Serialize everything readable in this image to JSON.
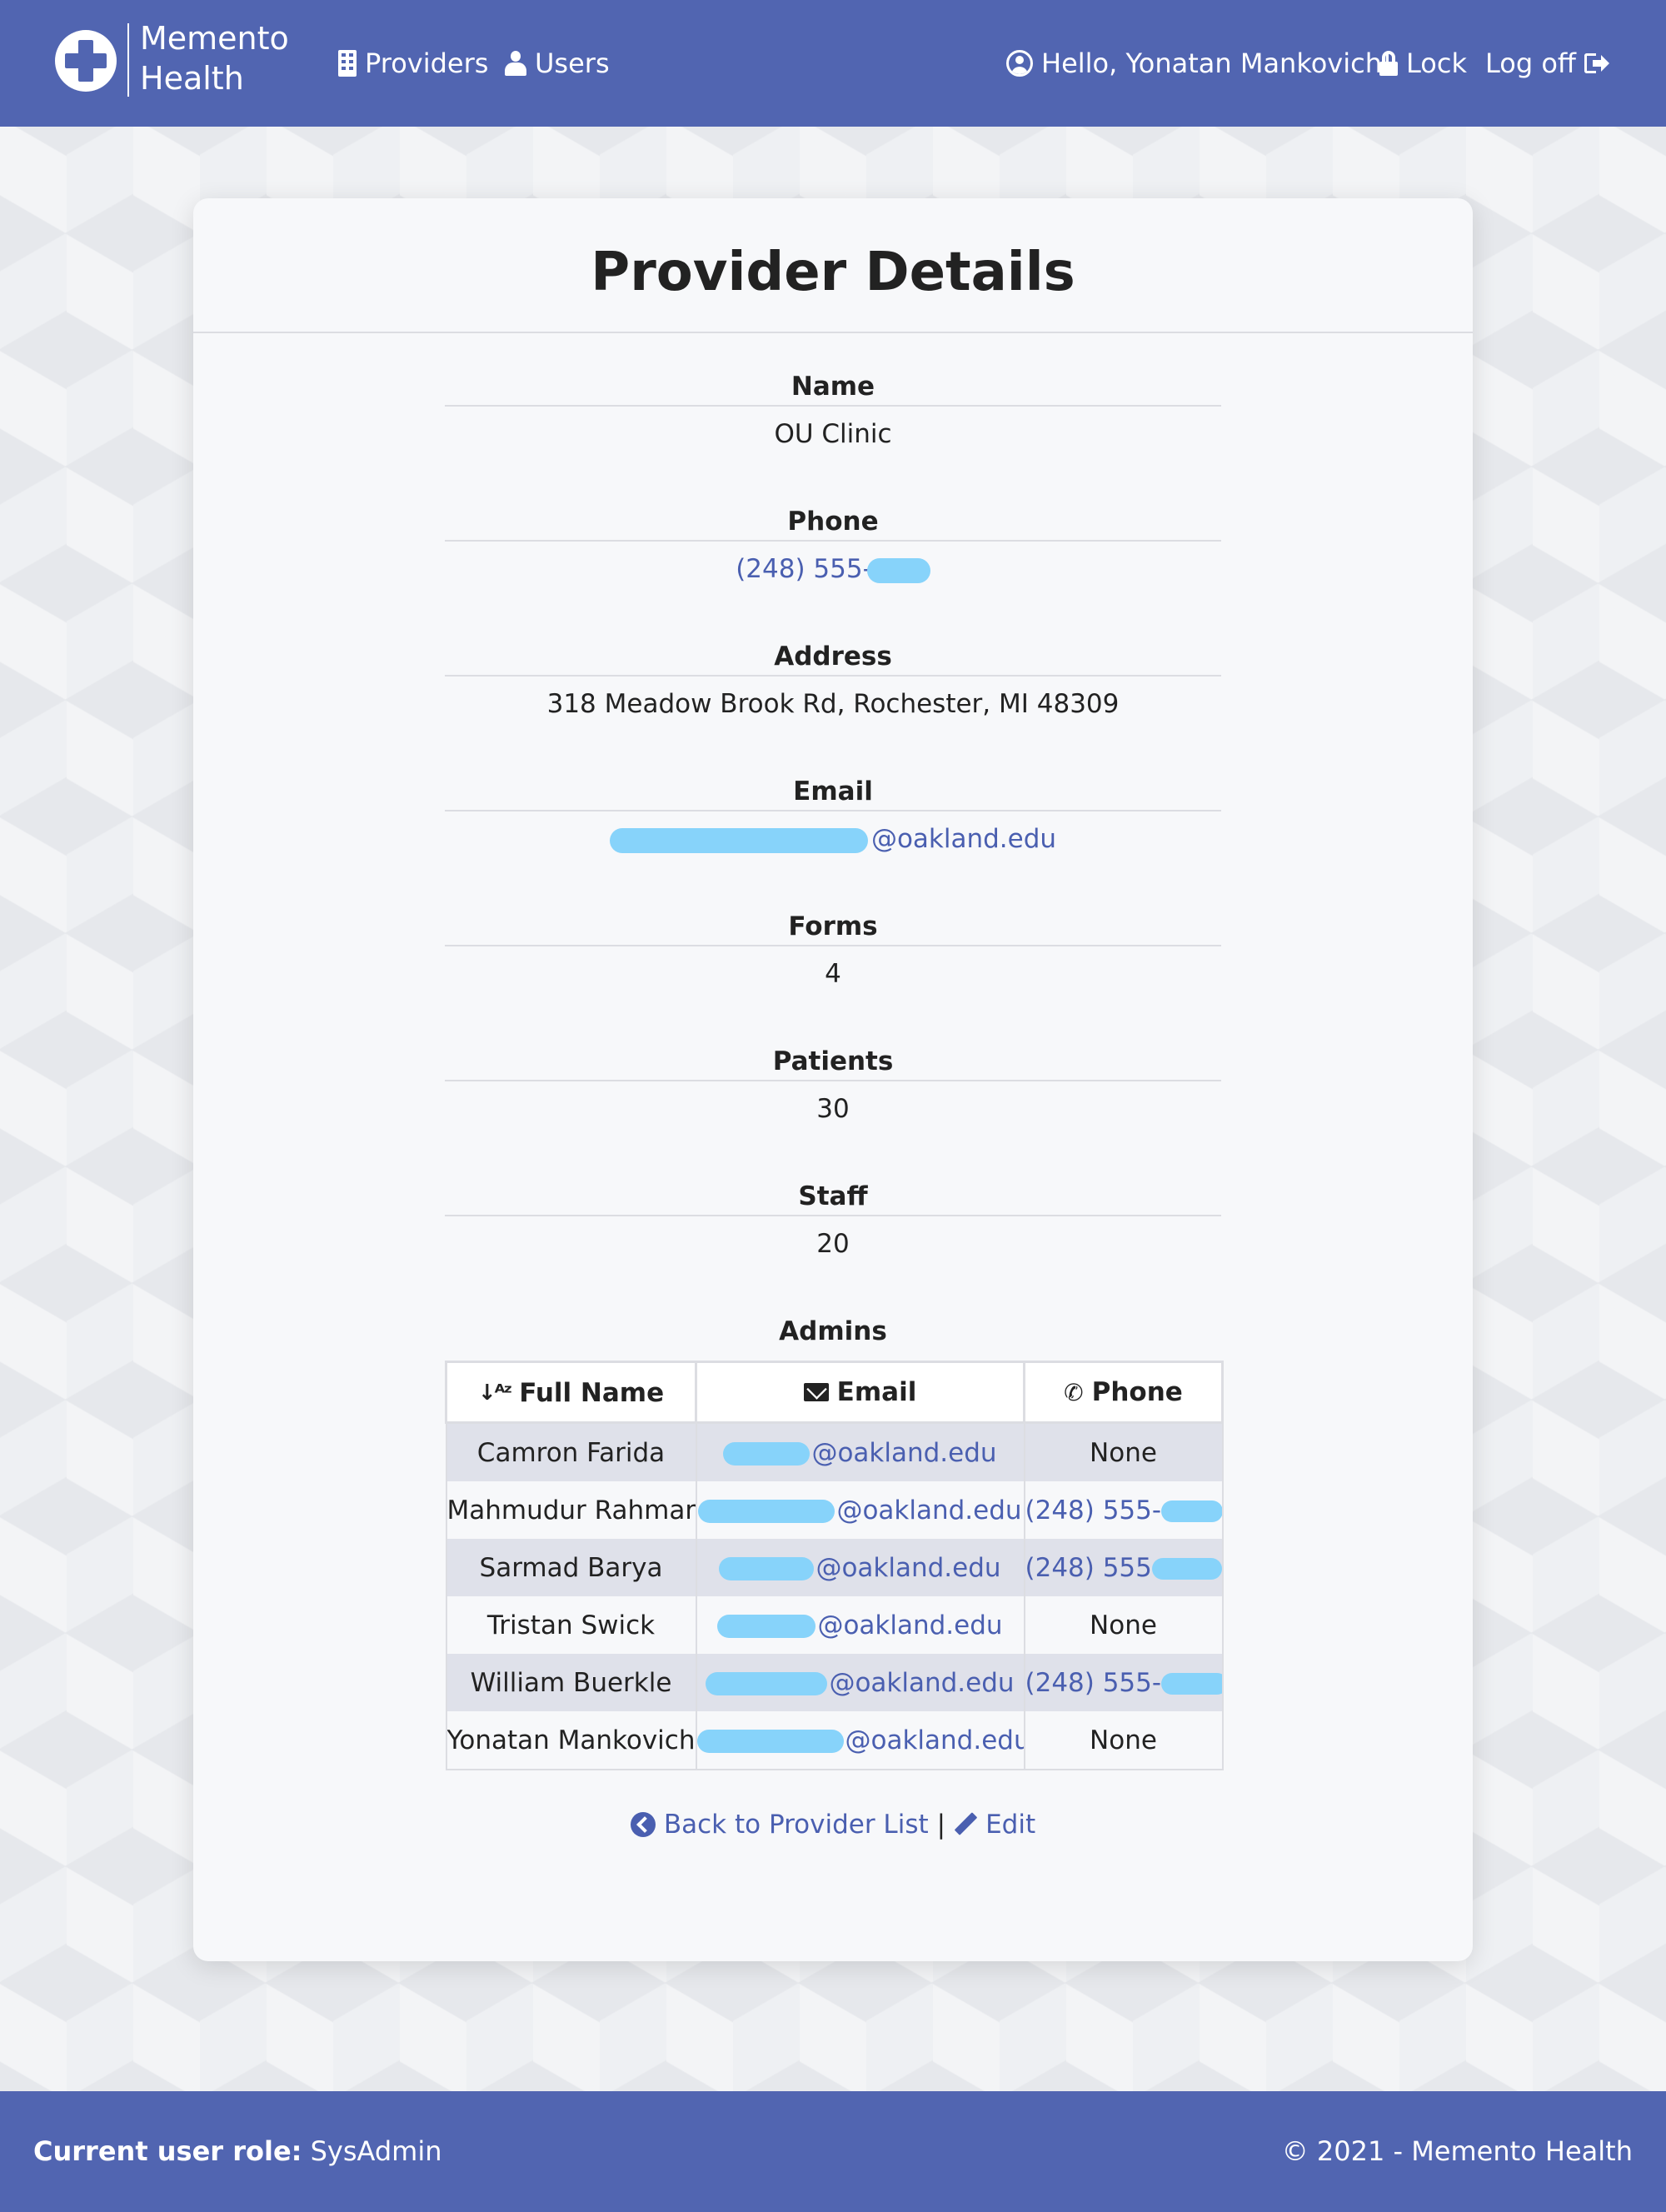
{
  "brand": {
    "line1": "Memento",
    "line2": "Health"
  },
  "nav": {
    "providers": "Providers",
    "users": "Users",
    "greeting": "Hello, Yonatan Mankovich!",
    "lock": "Lock",
    "logoff": "Log off"
  },
  "page": {
    "title": "Provider Details"
  },
  "details": {
    "name_label": "Name",
    "name_value": "OU Clinic",
    "phone_label": "Phone",
    "phone_value": "(248) 555-",
    "address_label": "Address",
    "address_value": "318 Meadow Brook Rd, Rochester, MI 48309",
    "email_label": "Email",
    "email_value": "@oakland.edu",
    "forms_label": "Forms",
    "forms_value": "4",
    "patients_label": "Patients",
    "patients_value": "30",
    "staff_label": "Staff",
    "staff_value": "20"
  },
  "admins": {
    "label": "Admins",
    "headers": {
      "name": "Full Name",
      "email": "Email",
      "phone": "Phone"
    },
    "rows": [
      {
        "name": "Camron Farida",
        "email": "@oakland.edu",
        "phone": "None"
      },
      {
        "name": "Mahmudur Rahman",
        "email": "@oakland.edu",
        "phone": "(248) 555-"
      },
      {
        "name": "Sarmad Barya",
        "email": "@oakland.edu",
        "phone": "(248) 555"
      },
      {
        "name": "Tristan Swick",
        "email": "@oakland.edu",
        "phone": "None"
      },
      {
        "name": "William Buerkle",
        "email": "@oakland.edu",
        "phone": "(248) 555-"
      },
      {
        "name": "Yonatan Mankovich",
        "email": "@oakland.edu",
        "phone": "None"
      }
    ]
  },
  "actions": {
    "back": "Back to Provider List",
    "separator": "|",
    "edit": "Edit"
  },
  "footer": {
    "role_label": "Current user role:",
    "role_value": "SysAdmin",
    "copyright": "© 2021 - Memento Health"
  },
  "colors": {
    "navbar": "#5165b1",
    "link": "#4a5fb0",
    "redaction": "#87d3fa",
    "card": "#f7f8fa"
  }
}
